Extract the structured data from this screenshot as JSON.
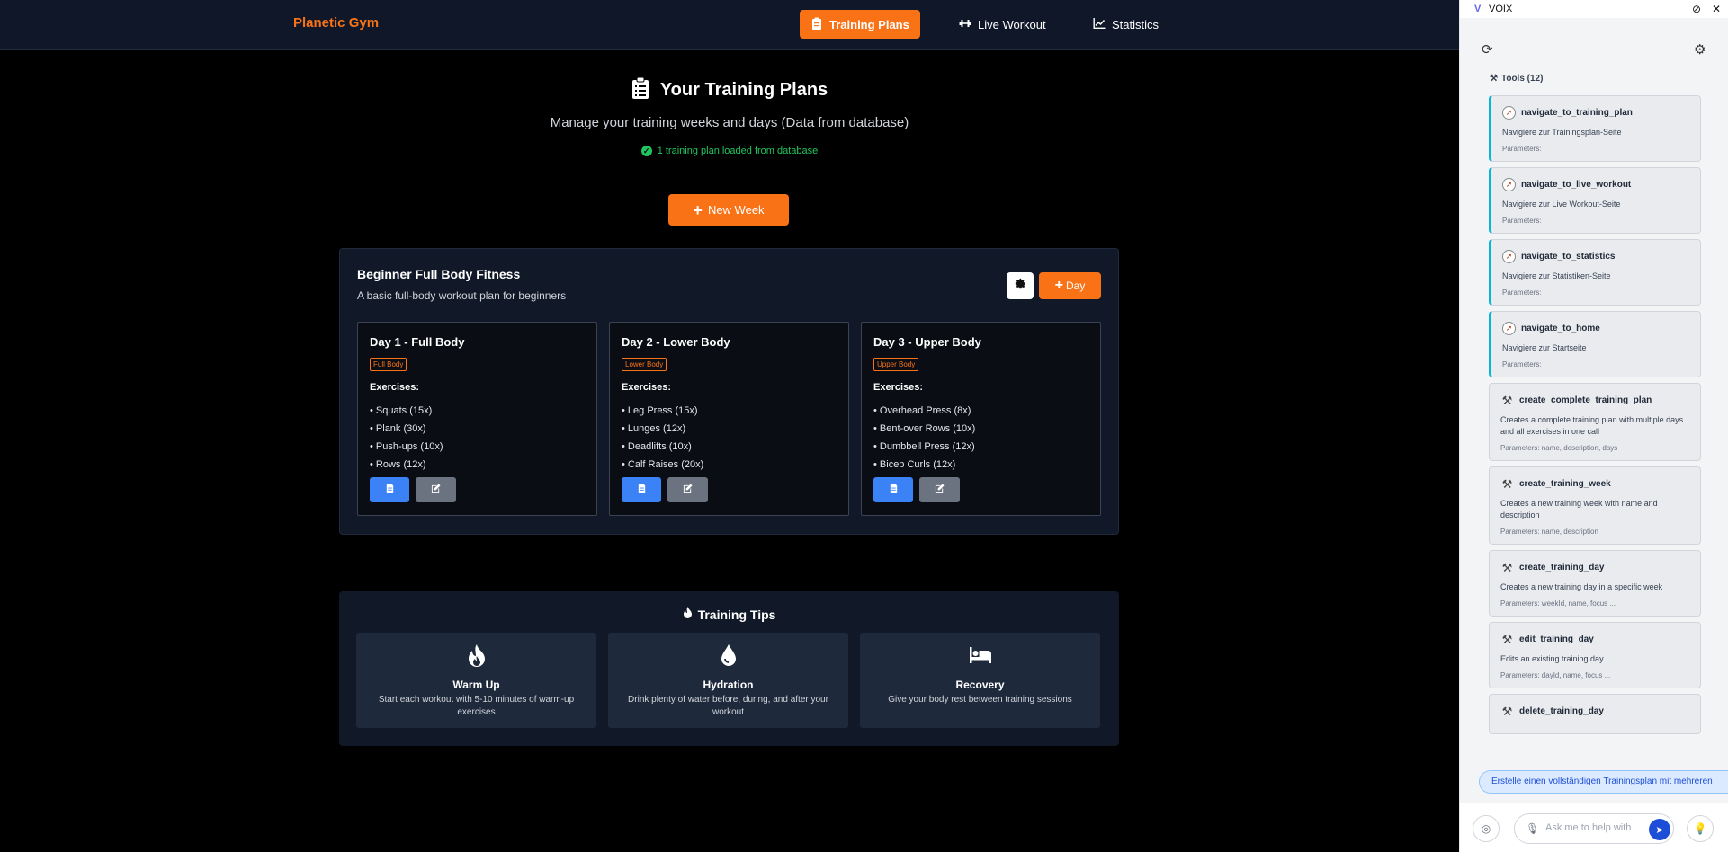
{
  "app": {
    "brand": "Planetic Gym",
    "nav": [
      {
        "label": "Training Plans",
        "icon": "clipboard-icon",
        "active": true
      },
      {
        "label": "Live Workout",
        "icon": "dumbbell-icon",
        "active": false
      },
      {
        "label": "Statistics",
        "icon": "chart-line-icon",
        "active": false
      }
    ]
  },
  "header": {
    "title": "Your Training Plans",
    "subtitle": "Manage your training weeks and days (Data from database)",
    "status": "1 training plan loaded from database",
    "new_week_label": "New Week"
  },
  "plan": {
    "name": "Beginner Full Body Fitness",
    "description": "A basic full-body workout plan for beginners",
    "add_day_label": "Day",
    "exercises_heading": "Exercises:",
    "days": [
      {
        "title": "Day 1 - Full Body",
        "focus": "Full Body",
        "exercises": [
          "• Squats (15x)",
          "• Plank (30x)",
          "• Push-ups (10x)",
          "• Rows (12x)"
        ]
      },
      {
        "title": "Day 2 - Lower Body",
        "focus": "Lower Body",
        "exercises": [
          "• Leg Press (15x)",
          "• Lunges (12x)",
          "• Deadlifts (10x)",
          "• Calf Raises (20x)"
        ]
      },
      {
        "title": "Day 3 - Upper Body",
        "focus": "Upper Body",
        "exercises": [
          "• Overhead Press (8x)",
          "• Bent-over Rows (10x)",
          "• Dumbbell Press (12x)",
          "• Bicep Curls (12x)"
        ]
      }
    ]
  },
  "tips": {
    "title": "Training Tips",
    "items": [
      {
        "title": "Warm Up",
        "text": "Start each workout with 5-10 minutes of warm-up exercises",
        "icon": "fire-icon"
      },
      {
        "title": "Hydration",
        "text": "Drink plenty of water before, during, and after your workout",
        "icon": "water-drop-icon"
      },
      {
        "title": "Recovery",
        "text": "Give your body rest between training sessions",
        "icon": "bed-icon"
      }
    ]
  },
  "voix": {
    "name": "VOIX",
    "logo": "V",
    "tools_heading": "Tools (12)",
    "tools": [
      {
        "name": "navigate_to_training_plan",
        "desc": "Navigiere zur Trainingsplan-Seite",
        "params": "Parameters:",
        "kind": "nav"
      },
      {
        "name": "navigate_to_live_workout",
        "desc": "Navigiere zur Live Workout-Seite",
        "params": "Parameters:",
        "kind": "nav"
      },
      {
        "name": "navigate_to_statistics",
        "desc": "Navigiere zur Statistiken-Seite",
        "params": "Parameters:",
        "kind": "nav"
      },
      {
        "name": "navigate_to_home",
        "desc": "Navigiere zur Startseite",
        "params": "Parameters:",
        "kind": "nav"
      },
      {
        "name": "create_complete_training_plan",
        "desc": "Creates a complete training plan with multiple days and all exercises in one call",
        "params": "Parameters: name, description, days",
        "kind": "tool"
      },
      {
        "name": "create_training_week",
        "desc": "Creates a new training week with name and description",
        "params": "Parameters: name, description",
        "kind": "tool"
      },
      {
        "name": "create_training_day",
        "desc": "Creates a new training day in a specific week",
        "params": "Parameters: weekId, name, focus ...",
        "kind": "tool"
      },
      {
        "name": "edit_training_day",
        "desc": "Edits an existing training day",
        "params": "Parameters: dayId, name, focus ...",
        "kind": "tool"
      },
      {
        "name": "delete_training_day",
        "desc": "",
        "params": "",
        "kind": "tool"
      }
    ],
    "suggestion": "Erstelle einen vollständigen Trainingsplan mit mehreren",
    "input_placeholder": "Ask me to help with"
  }
}
